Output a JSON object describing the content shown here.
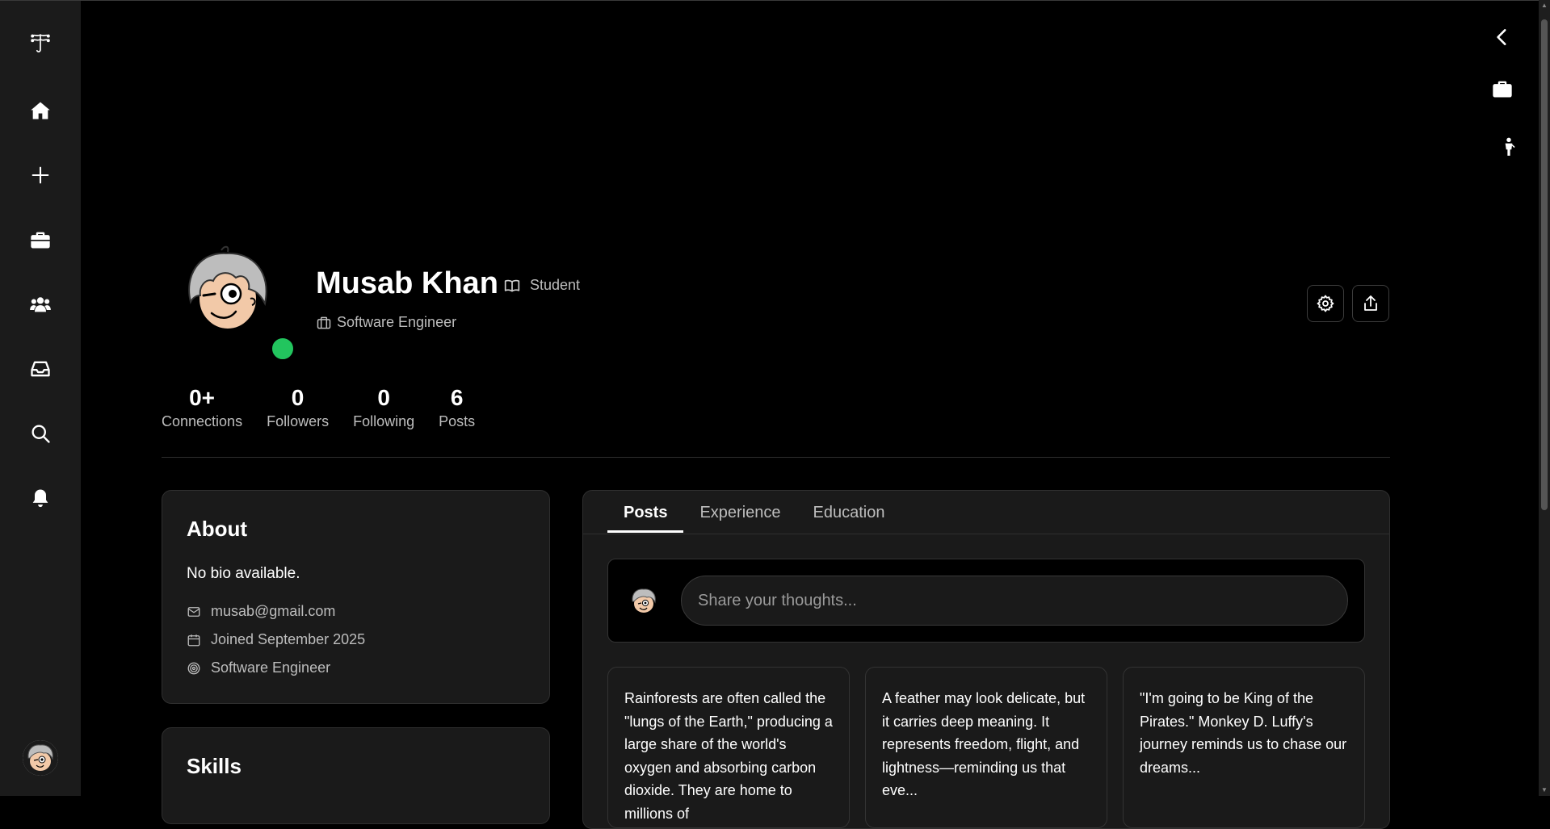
{
  "sidebar": {
    "logo": "logo-icon",
    "items": [
      {
        "name": "home-icon"
      },
      {
        "name": "plus-icon"
      },
      {
        "name": "briefcase-icon"
      },
      {
        "name": "users-icon"
      },
      {
        "name": "inbox-icon"
      },
      {
        "name": "search-icon"
      },
      {
        "name": "bell-icon"
      }
    ]
  },
  "right_rail": {
    "items": [
      "chevron-left-icon",
      "briefcase-icon",
      "person-icon"
    ]
  },
  "profile": {
    "name": "Musab Khan",
    "role": "Student",
    "title": "Software Engineer",
    "status_color": "#22c55e",
    "stats": [
      {
        "value": "0+",
        "label": "Connections"
      },
      {
        "value": "0",
        "label": "Followers"
      },
      {
        "value": "0",
        "label": "Following"
      },
      {
        "value": "6",
        "label": "Posts"
      }
    ]
  },
  "about": {
    "heading": "About",
    "bio": "No bio available.",
    "email": "musab@gmail.com",
    "joined": "Joined September 2025",
    "occupation": "Software Engineer"
  },
  "skills": {
    "heading": "Skills"
  },
  "tabs": [
    {
      "label": "Posts",
      "active": true
    },
    {
      "label": "Experience",
      "active": false
    },
    {
      "label": "Education",
      "active": false
    }
  ],
  "composer": {
    "placeholder": "Share your thoughts..."
  },
  "posts": [
    {
      "text": "Rainforests are often called the \"lungs of the Earth,\" producing a large share of the world's oxygen and absorbing carbon dioxide. They are home to millions of"
    },
    {
      "text": "A feather may look delicate, but it carries deep meaning. It represents freedom, flight, and lightness—reminding us that eve..."
    },
    {
      "text": "\"I'm going to be King of the Pirates.\" Monkey D. Luffy's journey reminds us to chase our dreams..."
    }
  ]
}
